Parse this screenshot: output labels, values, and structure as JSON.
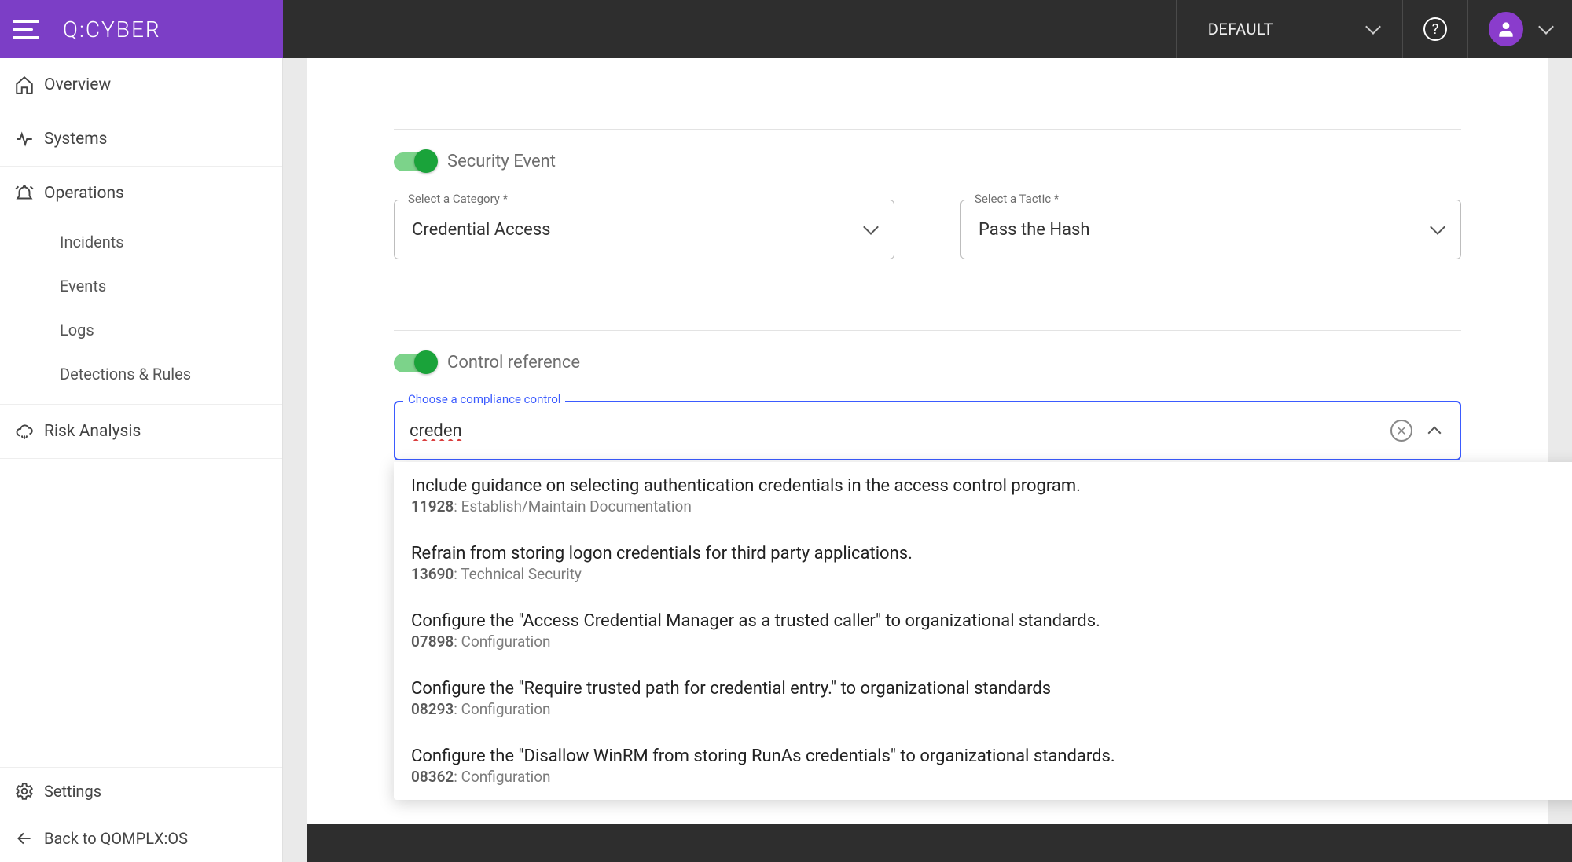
{
  "header": {
    "logo": "Q:CYBER",
    "workspace": "DEFAULT"
  },
  "sidebar": {
    "overview": "Overview",
    "systems": "Systems",
    "operations": "Operations",
    "subs": {
      "incidents": "Incidents",
      "events": "Events",
      "logs": "Logs",
      "detections": "Detections & Rules"
    },
    "risk": "Risk Analysis",
    "settings": "Settings",
    "back": "Back to QOMPLX:OS"
  },
  "form": {
    "securityEventLabel": "Security Event",
    "category": {
      "label": "Select a Category *",
      "value": "Credential Access"
    },
    "tactic": {
      "label": "Select a Tactic *",
      "value": "Pass the Hash"
    },
    "controlRefLabel": "Control reference",
    "compliance": {
      "label": "Choose a compliance control",
      "value": "creden"
    }
  },
  "options": [
    {
      "title": "Include guidance on selecting authentication credentials in the access control program.",
      "id": "11928",
      "category": "Establish/Maintain Documentation"
    },
    {
      "title": "Refrain from storing logon credentials for third party applications.",
      "id": "13690",
      "category": "Technical Security"
    },
    {
      "title": "Configure the \"Access Credential Manager as a trusted caller\" to organizational standards.",
      "id": "07898",
      "category": "Configuration"
    },
    {
      "title": "Configure the \"Require trusted path for credential entry.\" to organizational standards",
      "id": "08293",
      "category": "Configuration"
    },
    {
      "title": "Configure the \"Disallow WinRM from storing RunAs credentials\" to organizational standards.",
      "id": "08362",
      "category": "Configuration"
    }
  ]
}
